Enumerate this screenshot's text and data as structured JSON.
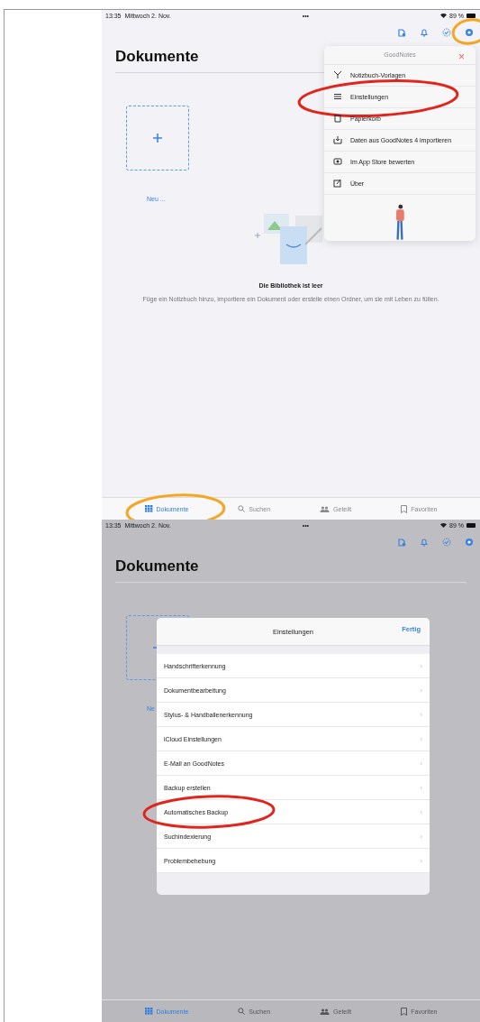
{
  "screens": [
    {
      "dimmed": false,
      "status": {
        "time": "13:35",
        "date": "Mittwoch 2. Nov.",
        "dots": "•••",
        "battery": "89 %"
      },
      "gear_circled": true,
      "title": "Dokumente",
      "new_label": "Neu ...",
      "empty": {
        "title": "Die Bibliothek ist leer",
        "text": "Füge ein Notizbuch hinzu, importiere ein Dokument oder erstelle einen Ordner, um sie mit Leben zu füllen."
      },
      "menu": {
        "title": "GoodNotes",
        "close": "×",
        "items": [
          {
            "kind": "templates",
            "label": "Notizbuch-Vorlagen",
            "circled": false
          },
          {
            "kind": "settings",
            "label": "Einstellungen",
            "circled": true
          },
          {
            "kind": "trash",
            "label": "Papierkorb",
            "circled": false
          },
          {
            "kind": "import",
            "label": "Daten aus GoodNotes 4 importieren",
            "circled": false
          },
          {
            "kind": "rate",
            "label": "Im App Store bewerten",
            "circled": false
          },
          {
            "kind": "about",
            "label": "Über",
            "circled": false
          }
        ]
      },
      "tabs": [
        {
          "kind": "grid",
          "label": "Dokumente",
          "selected": true,
          "circled": true
        },
        {
          "kind": "search",
          "label": "Suchen",
          "selected": false,
          "circled": false
        },
        {
          "kind": "people",
          "label": "Geteilt",
          "selected": false,
          "circled": false
        },
        {
          "kind": "bookmark",
          "label": "Favoriten",
          "selected": false,
          "circled": false
        }
      ]
    },
    {
      "dimmed": true,
      "status": {
        "time": "13:35",
        "date": "Mittwoch 2. Nov.",
        "dots": "•••",
        "battery": "89 %"
      },
      "gear_circled": false,
      "title": "Dokumente",
      "new_label": "Ne",
      "settings": {
        "title": "Einstellungen",
        "done": "Fertig",
        "rows": [
          {
            "label": "Handschrifterkennung",
            "chevron": "›",
            "circled": false
          },
          {
            "label": "Dokumentbearbeitung",
            "chevron": "›",
            "circled": false
          },
          {
            "label": "Stylus- & Handballenerkennung",
            "chevron": "›",
            "circled": false
          },
          {
            "label": "iCloud Einstellungen",
            "chevron": "›",
            "circled": false
          },
          {
            "label": "E-Mail an GoodNotes",
            "chevron": "›",
            "circled": false
          },
          {
            "label": "Backup erstellen",
            "chevron": "›",
            "circled": false
          },
          {
            "label": "Automatisches Backup",
            "chevron": "›",
            "circled": true
          },
          {
            "label": "Suchindexierung",
            "chevron": "›",
            "circled": false
          },
          {
            "label": "Problembehebung",
            "chevron": "›",
            "circled": false
          }
        ]
      },
      "tabs": [
        {
          "kind": "grid",
          "label": "Dokumente",
          "selected": true,
          "circled": false
        },
        {
          "kind": "search",
          "label": "Suchen",
          "selected": false,
          "circled": false
        },
        {
          "kind": "people",
          "label": "Geteilt",
          "selected": false,
          "circled": false
        },
        {
          "kind": "bookmark",
          "label": "Favoriten",
          "selected": false,
          "circled": false
        }
      ]
    }
  ]
}
